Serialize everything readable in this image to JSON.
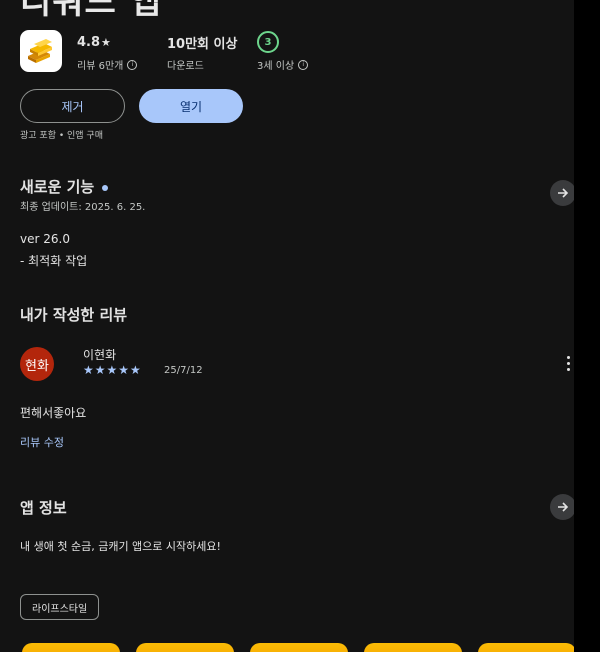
{
  "header": {
    "title_fragment": "리워드 앱"
  },
  "stats": {
    "rating_value": "4.8",
    "rating_star": "★",
    "reviews_label": "리뷰 6만개",
    "downloads_value": "10만회 이상",
    "downloads_label": "다운로드",
    "content_rating_badge": "3",
    "content_rating_label": "3세 이상"
  },
  "actions": {
    "remove_label": "제거",
    "open_label": "열기",
    "ads_note": "광고 포함 • 인앱 구매"
  },
  "whats_new": {
    "title": "새로운 기능",
    "updated": "최종 업데이트: 2025. 6. 25.",
    "version": "ver 26.0",
    "note": "- 최적화 작업"
  },
  "my_review": {
    "title": "내가 작성한 리뷰",
    "avatar_text": "현화",
    "author": "이현화",
    "stars": "★★★★★",
    "date": "25/7/12",
    "text": "편해서좋아요",
    "edit_link": "리뷰 수정"
  },
  "app_info": {
    "title": "앱 정보",
    "description": "내 생애 첫 순금, 금캐기 앱으로 시작하세요!",
    "category_chip": "라이프스타일"
  },
  "colors": {
    "background": "#131313",
    "accent": "#a8c7fa",
    "rating_green": "#6dd58c",
    "avatar_red": "#b3260c",
    "gold": "#fbbc05"
  },
  "icons": [
    "gold-bars-app-icon",
    "star-icon",
    "info-icon",
    "arrow-right-icon",
    "more-vert-icon"
  ]
}
